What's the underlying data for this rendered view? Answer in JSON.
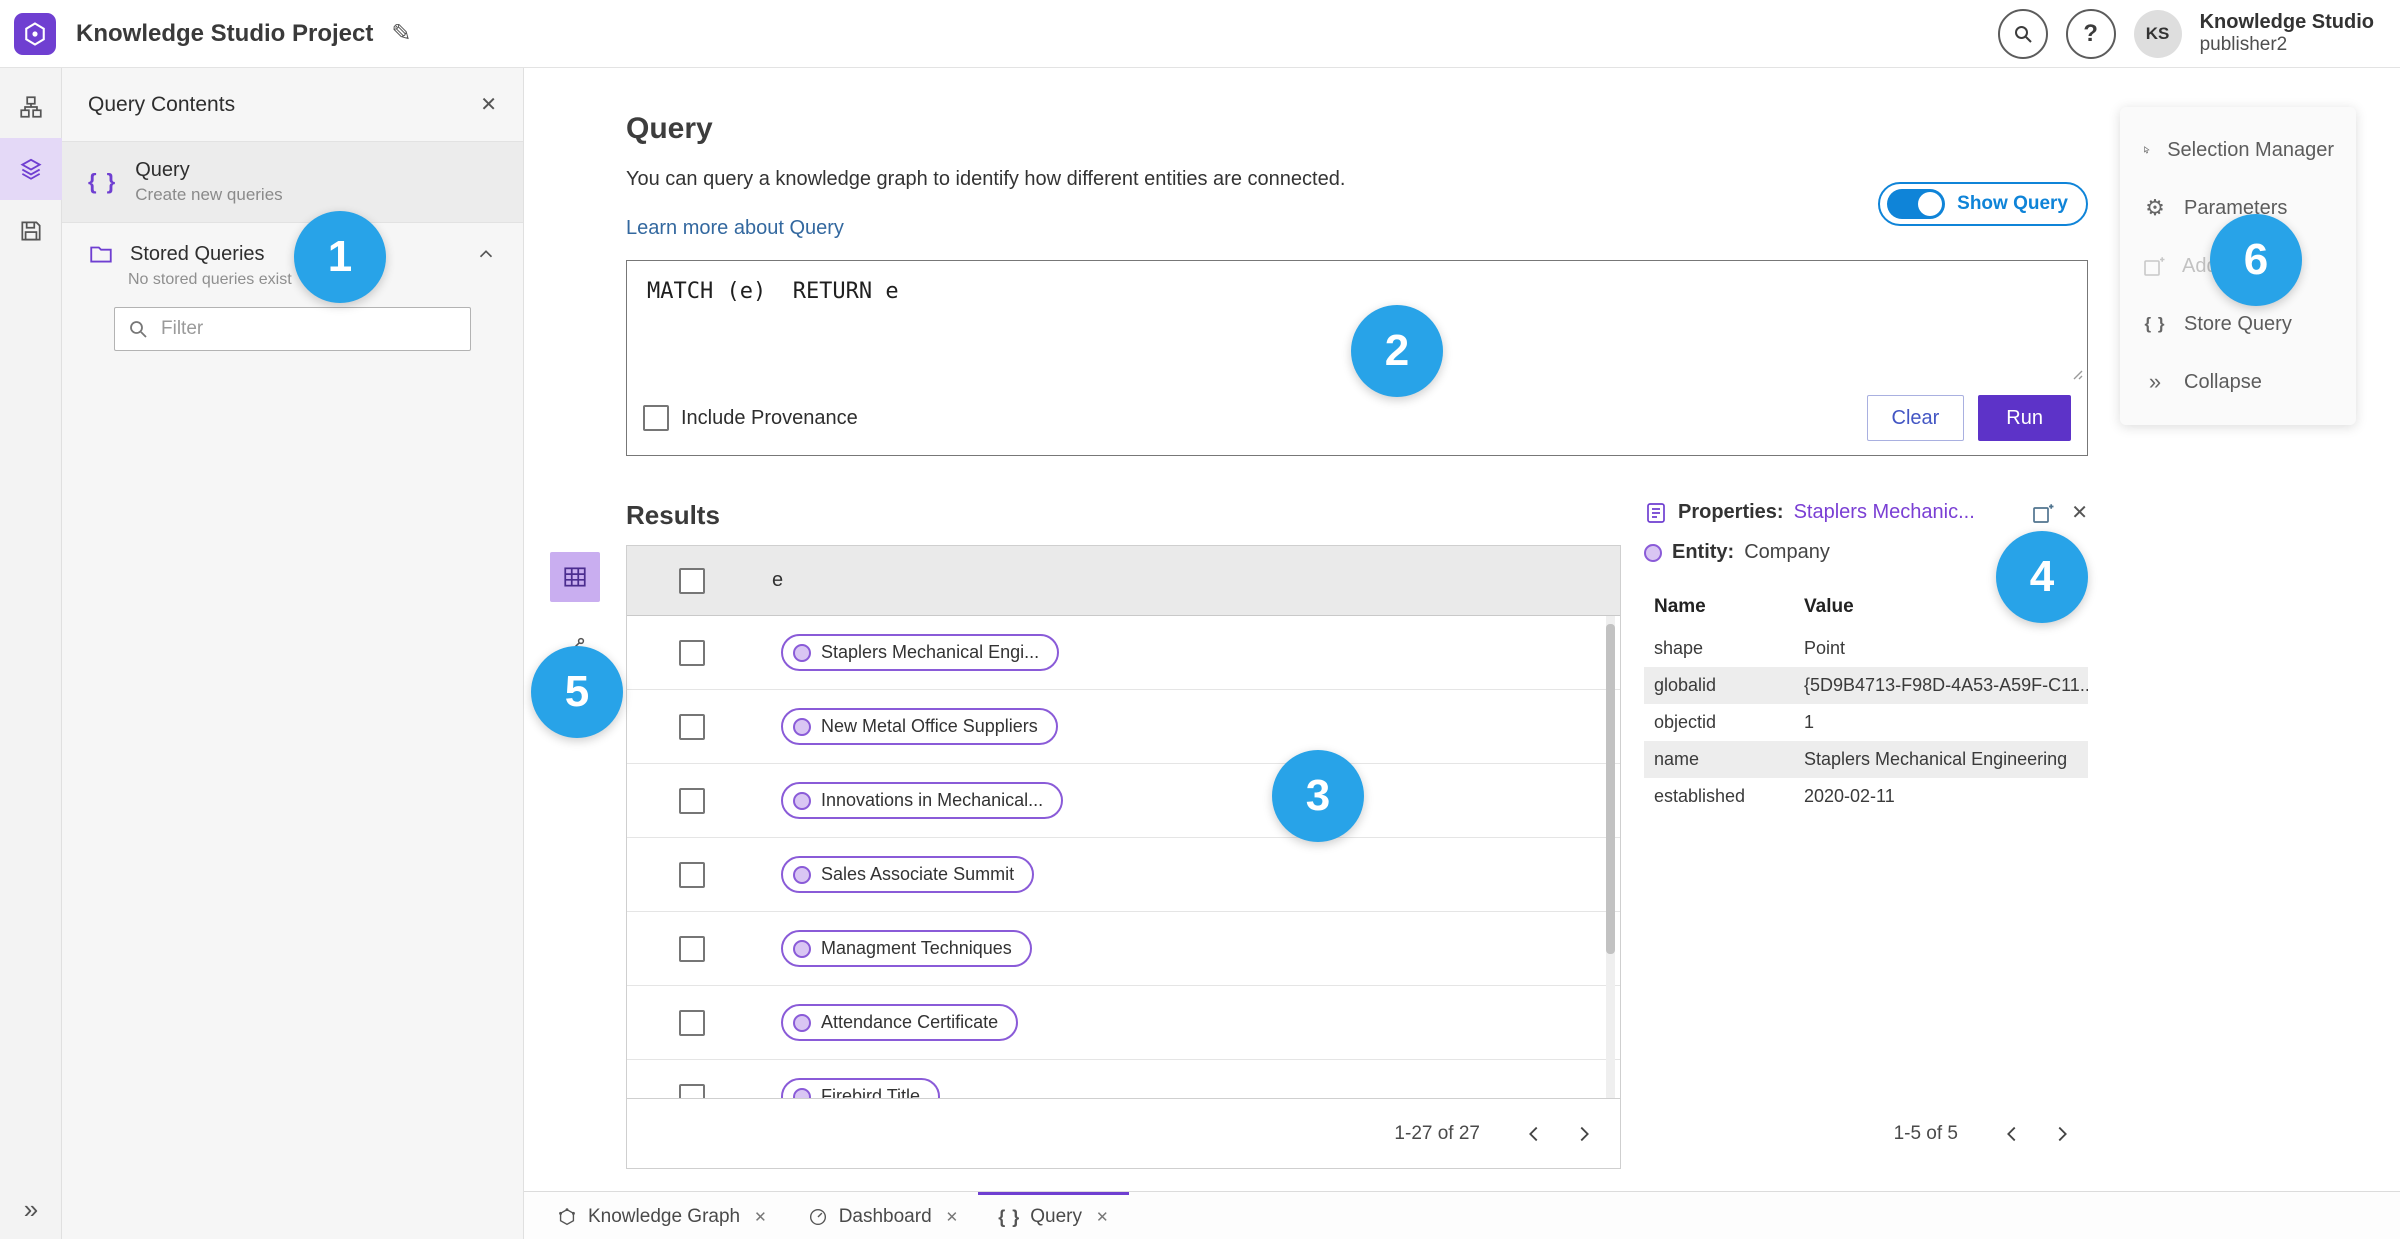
{
  "header": {
    "app_title": "Knowledge Studio Project",
    "user_name": "Knowledge Studio",
    "user_role": "publisher2",
    "avatar_initials": "KS",
    "help_glyph": "?"
  },
  "icons": {
    "pencil": "✎",
    "close": "✕",
    "braces": "{ }",
    "collapse": "»",
    "gear": "⚙"
  },
  "left_panel": {
    "title": "Query Contents",
    "query_label": "Query",
    "query_sub": "Create new queries",
    "stored_label": "Stored Queries",
    "stored_empty": "No stored queries exist",
    "filter_placeholder": "Filter"
  },
  "query": {
    "heading": "Query",
    "description": "You can query a knowledge graph to identify how different entities are connected.",
    "learn_more": "Learn more about Query",
    "show_query": "Show Query",
    "code": "MATCH (e)  RETURN e",
    "include_provenance": "Include Provenance",
    "clear": "Clear",
    "run": "Run"
  },
  "results": {
    "heading": "Results",
    "column": "e",
    "rows": [
      "Staplers Mechanical Engi...",
      "New Metal Office Suppliers",
      "Innovations in Mechanical...",
      "Sales Associate Summit",
      "Managment Techniques",
      "Attendance Certificate",
      "Firebird Title"
    ],
    "pagination": "1-27 of 27"
  },
  "properties": {
    "label": "Properties:",
    "link": "Staplers Mechanic...",
    "entity_label": "Entity:",
    "entity_value": "Company",
    "col_name": "Name",
    "col_value": "Value",
    "rows": [
      {
        "name": "shape",
        "value": "Point"
      },
      {
        "name": "globalid",
        "value": "{5D9B4713-F98D-4A53-A59F-C11..."
      },
      {
        "name": "objectid",
        "value": "1"
      },
      {
        "name": "name",
        "value": "Staplers Mechanical Engineering"
      },
      {
        "name": "established",
        "value": "2020-02-11"
      }
    ],
    "pagination": "1-5 of 5"
  },
  "side_menu": {
    "items": [
      {
        "label": "Selection Manager"
      },
      {
        "label": "Parameters"
      },
      {
        "label": "Add To Map",
        "disabled": true
      },
      {
        "label": "Store Query"
      },
      {
        "label": "Collapse"
      }
    ]
  },
  "tabs": [
    {
      "label": "Knowledge Graph"
    },
    {
      "label": "Dashboard"
    },
    {
      "label": "Query",
      "active": true
    }
  ],
  "badges": [
    "1",
    "2",
    "3",
    "4",
    "5",
    "6"
  ],
  "colors": {
    "accent_purple": "#6f3fd1",
    "run_purple": "#5d33c8",
    "chip_purple": "#8a5bd8",
    "toggle_blue": "#0f84d8",
    "badge_blue": "#28a3e8",
    "link_blue": "#33689f"
  }
}
